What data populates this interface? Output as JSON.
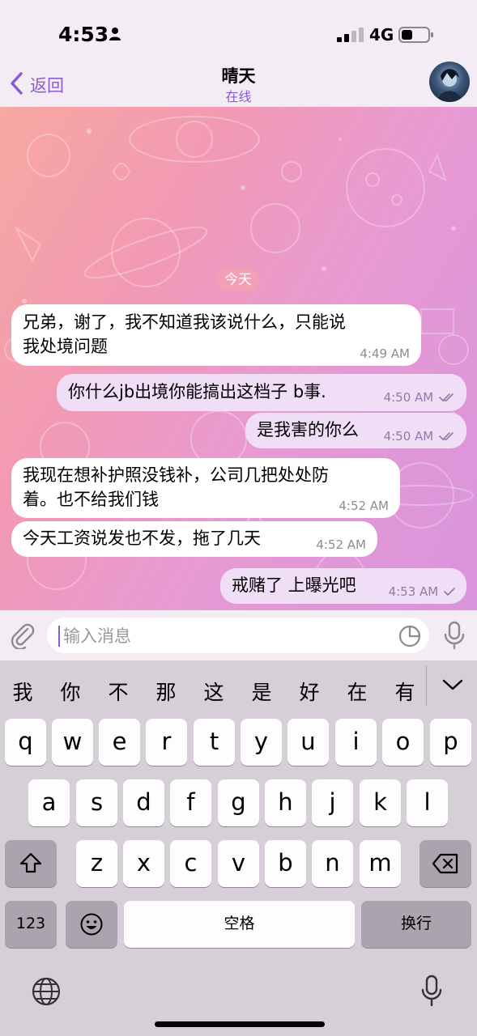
{
  "status_bar": {
    "time": "4:53",
    "network": "4G"
  },
  "nav": {
    "back_label": "返回",
    "title": "晴天",
    "status": "在线"
  },
  "chat": {
    "date_label": "今天",
    "messages": [
      {
        "direction": "in",
        "text_line1": "兄弟，谢了，我不知道我该说什么，只能说",
        "text_line2": "我处境问题",
        "time": "4:49 AM"
      },
      {
        "direction": "out",
        "text": "你什么jb出境你能搞出这档子 b事.",
        "time": "4:50 AM",
        "ticks": "double"
      },
      {
        "direction": "out",
        "text": "是我害的你么",
        "time": "4:50 AM",
        "ticks": "double"
      },
      {
        "direction": "in",
        "text_line1": "我现在想补护照没钱补，公司几把处处防",
        "text_line2": "着。也不给我们钱",
        "time": "4:52 AM"
      },
      {
        "direction": "in",
        "text": "今天工资说发也不发，拖了几天",
        "time": "4:52 AM"
      },
      {
        "direction": "out",
        "text": "戒赌了 上曝光吧",
        "time": "4:53 AM",
        "ticks": "single"
      }
    ]
  },
  "composer": {
    "placeholder": "输入消息",
    "value": ""
  },
  "keyboard": {
    "candidates": [
      "我",
      "你",
      "不",
      "那",
      "这",
      "是",
      "好",
      "在",
      "有"
    ],
    "row1": [
      "q",
      "w",
      "e",
      "r",
      "t",
      "y",
      "u",
      "i",
      "o",
      "p"
    ],
    "row2": [
      "a",
      "s",
      "d",
      "f",
      "g",
      "h",
      "j",
      "k",
      "l"
    ],
    "row3": [
      "z",
      "x",
      "c",
      "v",
      "b",
      "n",
      "m"
    ],
    "numbers_key": "123",
    "space_key": "空格",
    "return_key": "换行"
  },
  "colors": {
    "accent": "#8a5bd1",
    "outgoing_bubble": "#f0def7",
    "incoming_bubble": "#ffffff",
    "date_pill": "#f3a0b5"
  },
  "icons": [
    "person-icon",
    "signal-icon",
    "battery-icon",
    "back-chevron-icon",
    "attach-icon",
    "sticker-icon",
    "mic-icon",
    "shift-icon",
    "backspace-icon",
    "emoji-icon",
    "globe-icon",
    "dictation-icon",
    "chevron-down-icon"
  ]
}
